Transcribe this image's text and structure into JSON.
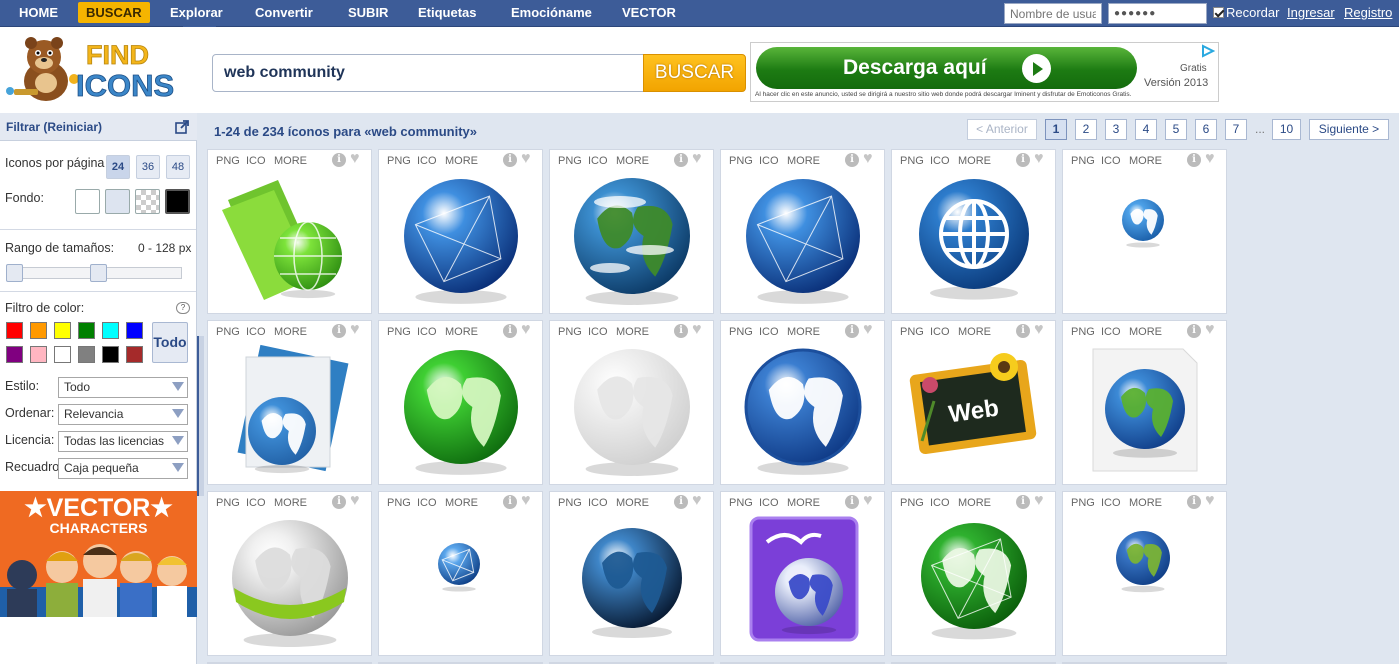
{
  "nav": {
    "items": [
      "HOME",
      "BUSCAR",
      "Explorar",
      "Convertir",
      "SUBIR",
      "Etiquetas",
      "Emocióname",
      "VECTOR"
    ],
    "active": "BUSCAR",
    "username_placeholder": "Nombre de usua",
    "password_value": "●●●●●●",
    "remember_label": "Recordar",
    "login_link": "Ingresar",
    "register_link": "Registro"
  },
  "header": {
    "logo_text_top": "FIND",
    "logo_text_bottom": "ICONS",
    "search_value": "web community",
    "search_button": "BUSCAR",
    "ad": {
      "button_label": "Descarga aquí",
      "gratis": "Gratis",
      "version": "Versión 2013",
      "fine_print": "Al hacer clic en este anuncio, usted se dirigirá a nuestro sitio web donde podrá descargar Iminent y disfrutar de Emoticonos Gratis."
    }
  },
  "sidebar": {
    "title": "Filtrar (Reiniciar)",
    "per_page_label": "Iconos por página",
    "per_page_options": [
      "24",
      "36",
      "48"
    ],
    "per_page_selected": "24",
    "background_label": "Fondo:",
    "size_range_label": "Rango de tamaños:",
    "size_range_value": "0 - 128 px",
    "size_range_min": 0,
    "size_range_max": 128,
    "color_filter_label": "Filtro de color:",
    "color_all_label": "Todo",
    "colors": [
      "#ff0000",
      "#ff9900",
      "#ffff00",
      "#008000",
      "#00ffff",
      "#0000ff",
      "#800080",
      "#ffb6c1",
      "#ffffff",
      "#808080",
      "#000000",
      "#a52a2a"
    ],
    "style_label": "Estilo:",
    "style_value": "Todo",
    "order_label": "Ordenar:",
    "order_value": "Relevancia",
    "license_label": "Licencia:",
    "license_value": "Todas las licencias",
    "frame_label": "Recuadro",
    "frame_value": "Caja pequeña",
    "promo_line1": "★VECTOR★",
    "promo_line2": "CHARACTERS"
  },
  "results": {
    "title": "1-24 de 234 íconos para «web community»",
    "prev_label": "< Anterior",
    "next_label": "Siguiente >",
    "pages": [
      "1",
      "2",
      "3",
      "4",
      "5",
      "6",
      "7",
      "10"
    ],
    "current_page": "1",
    "ellipsis": "...",
    "card_labels": {
      "png": "PNG",
      "ico": "ICO",
      "more": "MORE",
      "info": "i",
      "fav": "♥"
    },
    "icons": [
      "folder-globe-icon",
      "blue-network-globe-icon",
      "earth-clouds-icon",
      "blue-network-globe-icon",
      "blue-www-globe-icon",
      "small-earth-icon",
      "document-globe-icon",
      "green-globe-icon",
      "white-globe-icon",
      "blue-world-map-icon",
      "web-chalkboard-icon",
      "earth-document-icon",
      "silver-green-globe-icon",
      "small-network-globe-icon",
      "dark-blue-globe-icon",
      "purple-openoffice-globe-icon",
      "green-network-globe-icon",
      "small-blue-green-globe-icon"
    ]
  }
}
